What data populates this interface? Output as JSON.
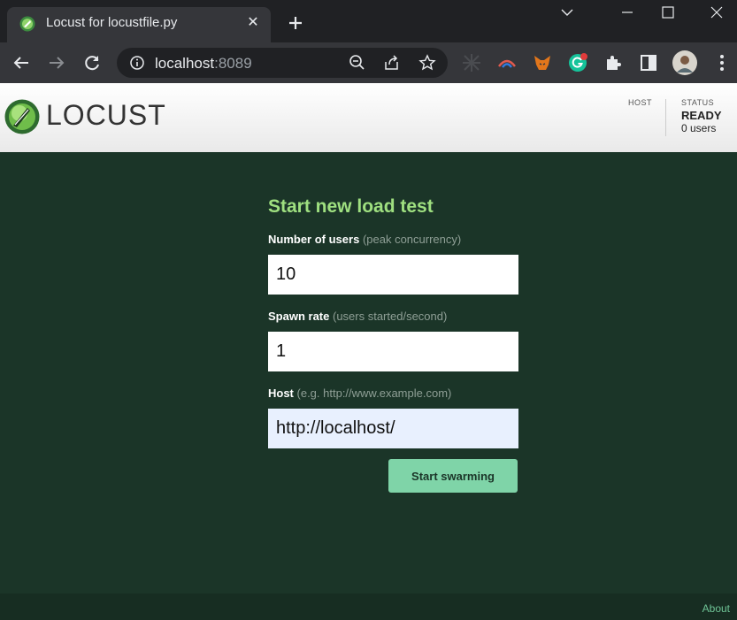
{
  "browser": {
    "tab_title": "Locust for locustfile.py",
    "url_host": "localhost",
    "url_port": ":8089"
  },
  "header": {
    "logo_text": "LOCUST",
    "host_label": "HOST",
    "status_label": "STATUS",
    "status_value": "READY",
    "users_text": "0 users"
  },
  "form": {
    "title": "Start new load test",
    "users_label": "Number of users",
    "users_hint": "(peak concurrency)",
    "users_value": "10",
    "spawn_label": "Spawn rate",
    "spawn_hint": "(users started/second)",
    "spawn_value": "1",
    "host_label": "Host",
    "host_hint": "(e.g. http://www.example.com)",
    "host_value": "http://localhost/",
    "submit_label": "Start swarming"
  },
  "footer": {
    "about_label": "About"
  },
  "colors": {
    "background": "#1b3528",
    "title_green": "#9fe080",
    "button": "#7fd4a8"
  }
}
